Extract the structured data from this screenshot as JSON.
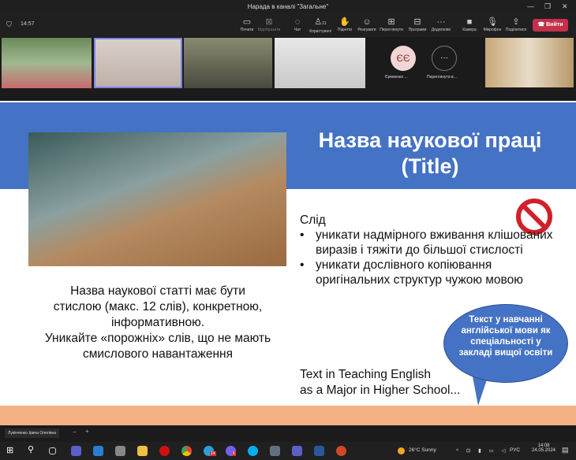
{
  "window": {
    "title": "Нарада в каналі \"Загальне\""
  },
  "meeting": {
    "timer": "14:57",
    "toolbar": [
      {
        "label": "Почати",
        "icon": "share-screen-icon"
      },
      {
        "label": "Відобразити",
        "icon": "stop-share-icon"
      },
      {
        "label": "Чат",
        "icon": "chat-icon"
      },
      {
        "label": "Користувачі",
        "icon": "people-icon",
        "count": "21"
      },
      {
        "label": "Підняти",
        "icon": "hand-icon"
      },
      {
        "label": "Реагувати",
        "icon": "emoji-icon"
      },
      {
        "label": "Переглянути",
        "icon": "grid-icon"
      },
      {
        "label": "Програми",
        "icon": "apps-icon"
      },
      {
        "label": "Додатково",
        "icon": "more-icon"
      },
      {
        "label": "Камера",
        "icon": "camera-icon"
      },
      {
        "label": "Мікрофон",
        "icon": "mic-icon"
      },
      {
        "label": "Поділитися",
        "icon": "share-icon"
      }
    ],
    "leave": "Вийти",
    "participants": [
      {
        "initials": "ЄЄ",
        "name": "Єременко ..."
      },
      {
        "name": "Переглянути в..."
      }
    ],
    "presenter": "Лукінченко Ірина Олегівна",
    "zoom_minus": "−",
    "zoom_plus": "+"
  },
  "slide": {
    "title": "Назва наукової праці (Title)",
    "left_text": [
      "Назва наукової статті має бути",
      "стислою (макс. 12 слів), конкретною,",
      "інформативною.",
      "Уникайте «порожніх» слів, що не мають",
      "смислового навантаження"
    ],
    "follow": "Слід",
    "bullets": [
      "уникати надмірного вживання клішованих виразів і тяжіти до більшої стислості",
      "уникати дослівного копіювання оригінальних структур чужою мовою"
    ],
    "english": [
      "Text in Teaching English",
      "as a Major in Higher School..."
    ],
    "bubble": "Текст у навчанні англійської мови як спеціальності у закладі вищої освіти"
  },
  "taskbar": {
    "weather": "26°C  Sunny",
    "lang": "РУС",
    "time": "14:08",
    "date": "24.05.2024",
    "badges": {
      "telegram": "14",
      "viber": "6"
    }
  },
  "colors": {
    "slide_blue": "#4472c4",
    "peach": "#f4b183",
    "leave": "#c4314b"
  }
}
